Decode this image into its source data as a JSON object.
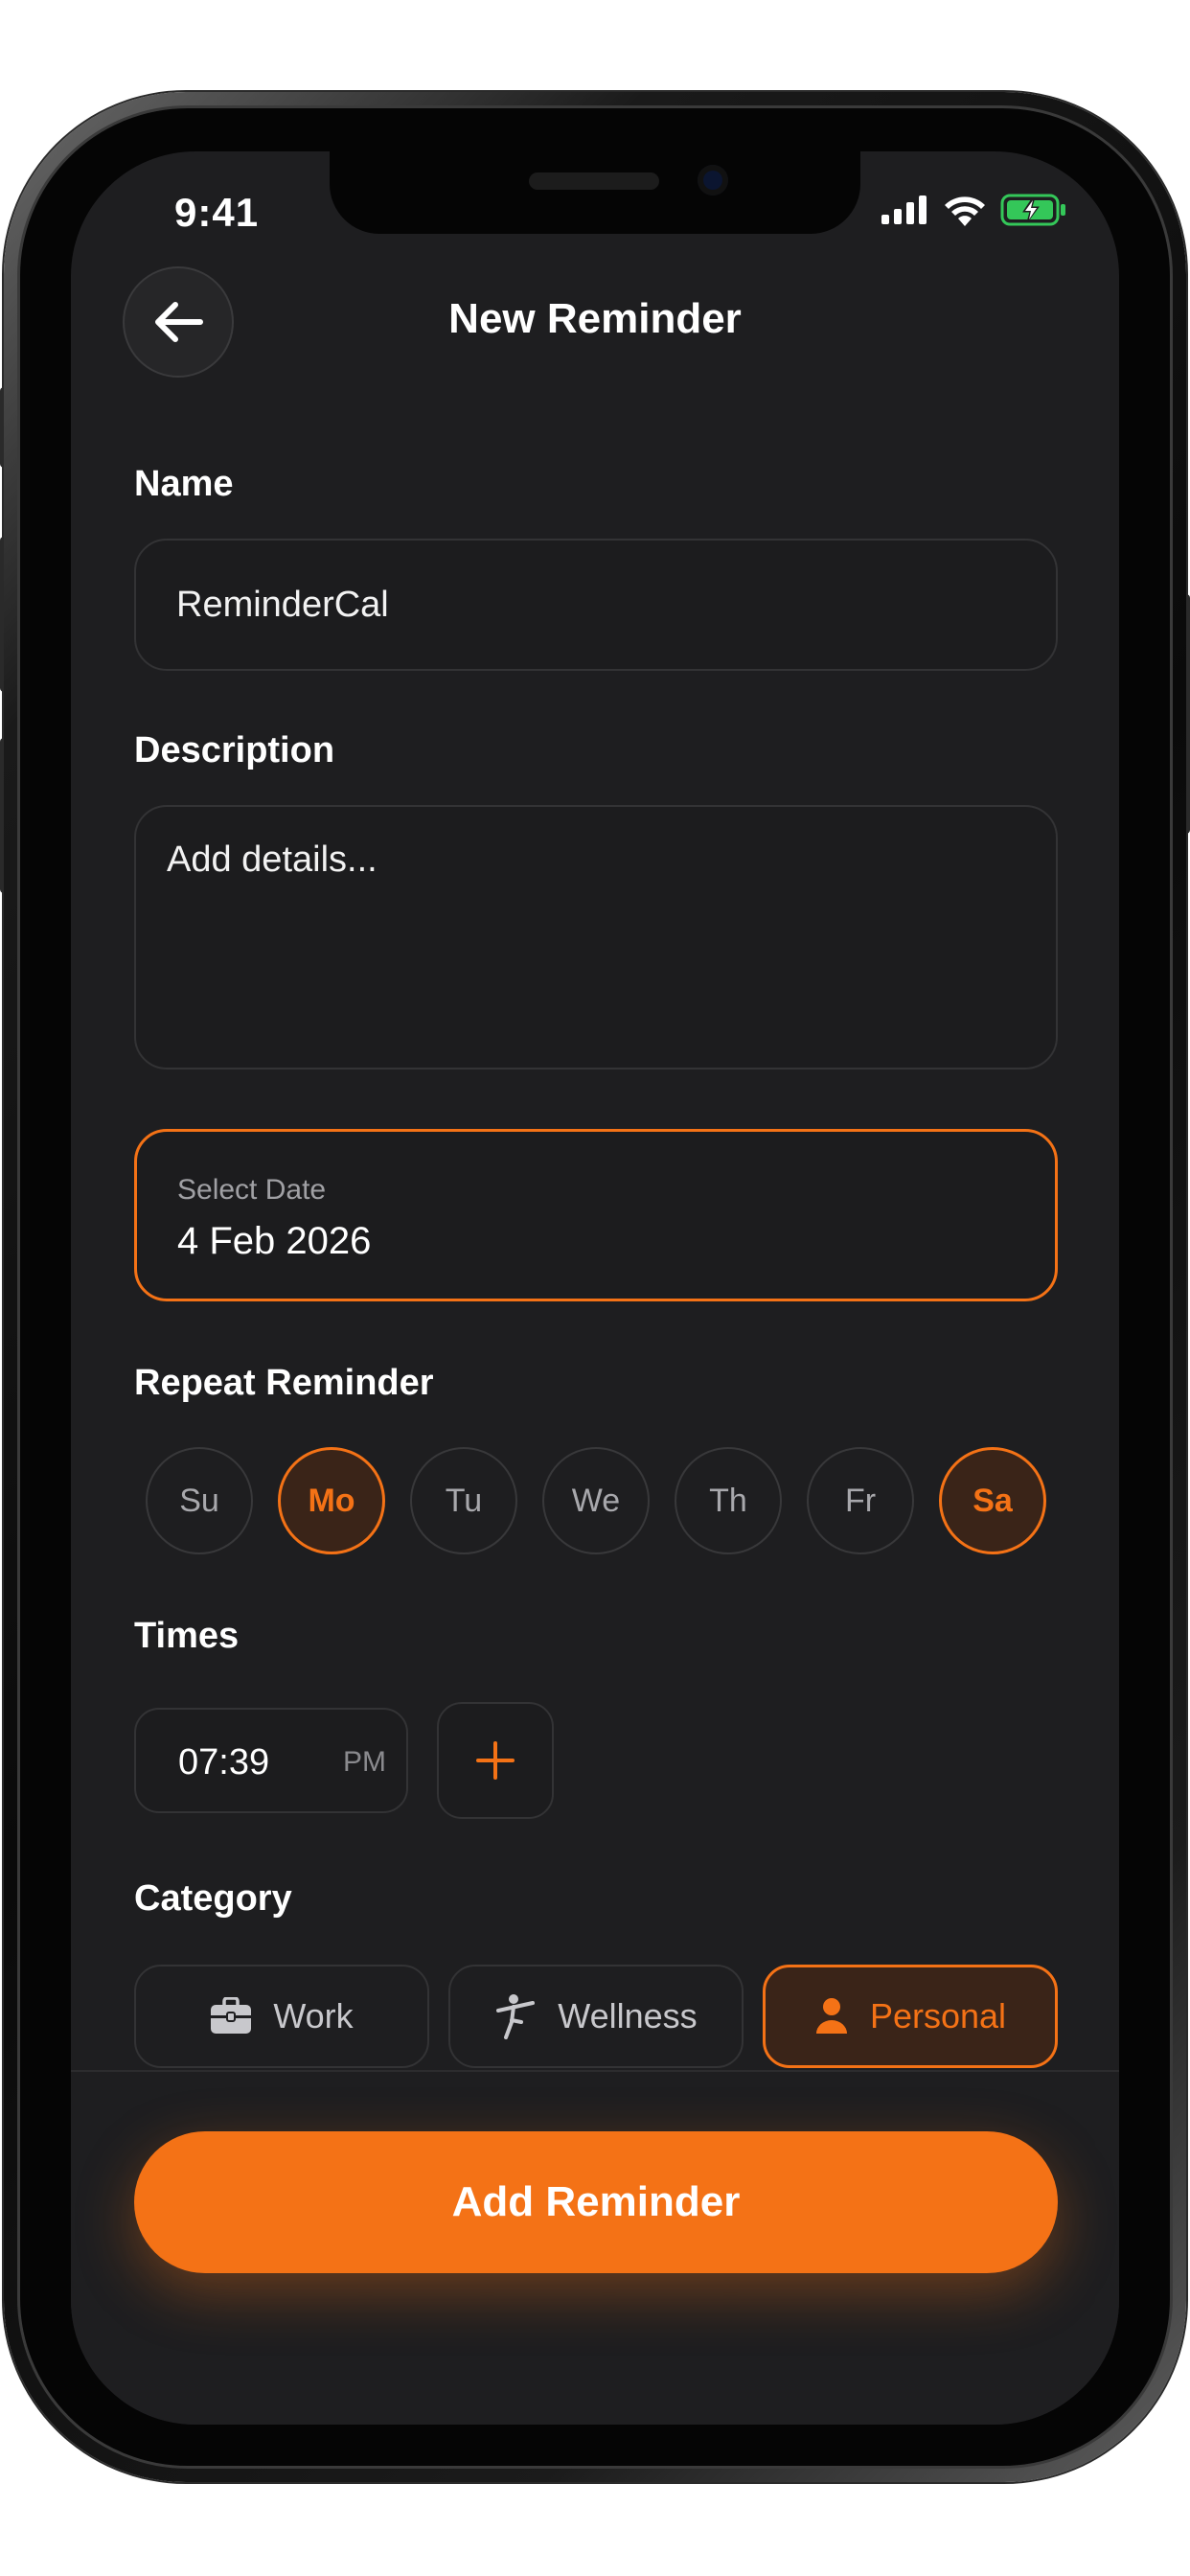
{
  "status_bar": {
    "time": "9:41"
  },
  "header": {
    "title": "New Reminder"
  },
  "form": {
    "name_label": "Name",
    "name_value": "ReminderCal",
    "description_label": "Description",
    "description_placeholder": "Add details...",
    "date_label": "Select Date",
    "date_value": "4 Feb 2026"
  },
  "repeat": {
    "label": "Repeat Reminder",
    "days": [
      {
        "label": "Su",
        "selected": false
      },
      {
        "label": "Mo",
        "selected": true
      },
      {
        "label": "Tu",
        "selected": false
      },
      {
        "label": "We",
        "selected": false
      },
      {
        "label": "Th",
        "selected": false
      },
      {
        "label": "Fr",
        "selected": false
      },
      {
        "label": "Sa",
        "selected": true
      }
    ]
  },
  "times": {
    "label": "Times",
    "entries": [
      {
        "time": "07:39",
        "period": "PM"
      }
    ]
  },
  "category": {
    "label": "Category",
    "options": [
      {
        "label": "Work",
        "icon": "briefcase-icon",
        "selected": false
      },
      {
        "label": "Wellness",
        "icon": "yoga-icon",
        "selected": false
      },
      {
        "label": "Personal",
        "icon": "person-icon",
        "selected": true
      }
    ]
  },
  "actions": {
    "submit_label": "Add Reminder"
  },
  "colors": {
    "accent": "#F47216",
    "background": "#1E1E20",
    "battery": "#34C759"
  }
}
